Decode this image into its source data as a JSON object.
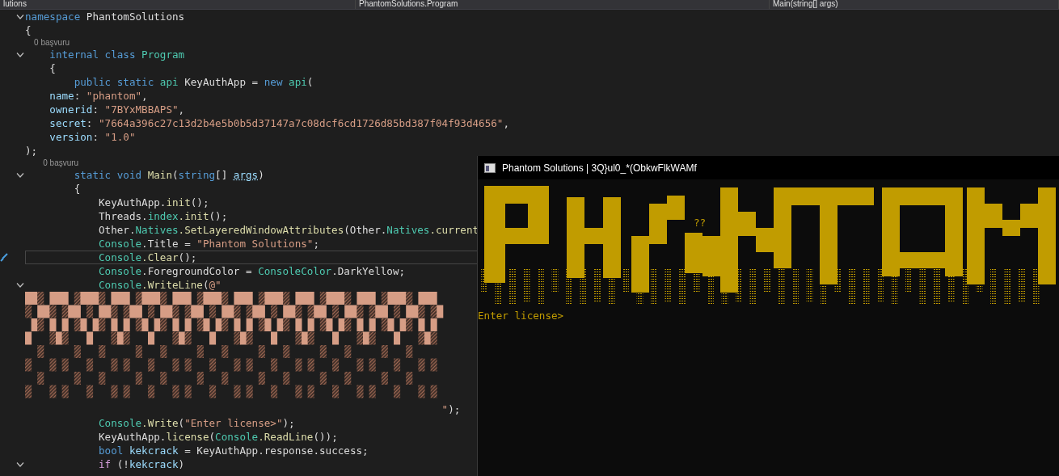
{
  "nav_bar": [
    {
      "label": "lutions"
    },
    {
      "label": "PhantomSolutions.Program"
    },
    {
      "label": "Main(string[] args)"
    }
  ],
  "code_lines": [
    {
      "kind": "code",
      "fold": true,
      "current": false,
      "tokens": [
        {
          "kind": "keyword",
          "text": "namespace "
        },
        {
          "kind": "plain",
          "text": "PhantomSolutions"
        }
      ]
    },
    {
      "kind": "code",
      "fold": false,
      "current": false,
      "tokens": [
        {
          "kind": "plain",
          "text": "{"
        }
      ]
    },
    {
      "kind": "codelens",
      "fold": false,
      "current": false,
      "tokens": [
        {
          "kind": "lens",
          "text": "    0 başvuru"
        }
      ]
    },
    {
      "kind": "code",
      "fold": true,
      "current": false,
      "tokens": [
        {
          "kind": "keyword",
          "text": "    internal class "
        },
        {
          "kind": "type",
          "text": "Program"
        }
      ]
    },
    {
      "kind": "code",
      "fold": false,
      "current": false,
      "tokens": [
        {
          "kind": "plain",
          "text": "    {"
        }
      ]
    },
    {
      "kind": "code",
      "fold": false,
      "current": false,
      "tokens": [
        {
          "kind": "keyword",
          "text": "        public static "
        },
        {
          "kind": "type",
          "text": "api"
        },
        {
          "kind": "plain",
          "text": " KeyAuthApp = "
        },
        {
          "kind": "keyword",
          "text": "new "
        },
        {
          "kind": "type",
          "text": "api"
        },
        {
          "kind": "plain",
          "text": "("
        }
      ]
    },
    {
      "kind": "code",
      "fold": false,
      "current": false,
      "tokens": [
        {
          "kind": "variable",
          "text": "    name"
        },
        {
          "kind": "plain",
          "text": ": "
        },
        {
          "kind": "string",
          "text": "\"phantom\""
        },
        {
          "kind": "plain",
          "text": ","
        }
      ]
    },
    {
      "kind": "code",
      "fold": false,
      "current": false,
      "tokens": [
        {
          "kind": "variable",
          "text": "    ownerid"
        },
        {
          "kind": "plain",
          "text": ": "
        },
        {
          "kind": "string",
          "text": "\"7BYxMBBAPS\""
        },
        {
          "kind": "plain",
          "text": ","
        }
      ]
    },
    {
      "kind": "code",
      "fold": false,
      "current": false,
      "tokens": [
        {
          "kind": "variable",
          "text": "    secret"
        },
        {
          "kind": "plain",
          "text": ": "
        },
        {
          "kind": "string",
          "text": "\"7664a396c27c13d2b4e5b0b5d37147a7c08dcf6cd1726d85bd387f04f93d4656\""
        },
        {
          "kind": "plain",
          "text": ","
        }
      ]
    },
    {
      "kind": "code",
      "fold": false,
      "current": false,
      "tokens": [
        {
          "kind": "variable",
          "text": "    version"
        },
        {
          "kind": "plain",
          "text": ": "
        },
        {
          "kind": "string",
          "text": "\"1.0\""
        }
      ]
    },
    {
      "kind": "code",
      "fold": false,
      "current": false,
      "tokens": [
        {
          "kind": "plain",
          "text": ");"
        }
      ]
    },
    {
      "kind": "codelens",
      "fold": false,
      "current": false,
      "tokens": [
        {
          "kind": "lens",
          "text": "        0 başvuru"
        }
      ]
    },
    {
      "kind": "code",
      "fold": true,
      "current": false,
      "tokens": [
        {
          "kind": "keyword",
          "text": "        static void "
        },
        {
          "kind": "method",
          "text": "Main"
        },
        {
          "kind": "plain",
          "text": "("
        },
        {
          "kind": "keyword",
          "text": "string"
        },
        {
          "kind": "plain",
          "text": "[] "
        },
        {
          "kind": "parameter",
          "text": "args"
        },
        {
          "kind": "plain",
          "text": ")"
        }
      ]
    },
    {
      "kind": "code",
      "fold": false,
      "current": false,
      "tokens": [
        {
          "kind": "plain",
          "text": "        {"
        }
      ]
    },
    {
      "kind": "code",
      "fold": false,
      "current": false,
      "tokens": [
        {
          "kind": "plain",
          "text": "            KeyAuthApp."
        },
        {
          "kind": "method",
          "text": "init"
        },
        {
          "kind": "plain",
          "text": "();"
        }
      ]
    },
    {
      "kind": "code",
      "fold": false,
      "current": false,
      "tokens": [
        {
          "kind": "plain",
          "text": "            Threads."
        },
        {
          "kind": "type",
          "text": "index"
        },
        {
          "kind": "method",
          "text": ".init"
        },
        {
          "kind": "plain",
          "text": "();"
        }
      ]
    },
    {
      "kind": "code",
      "fold": false,
      "current": false,
      "tokens": [
        {
          "kind": "plain",
          "text": "            Other."
        },
        {
          "kind": "type",
          "text": "Natives"
        },
        {
          "kind": "method",
          "text": ".SetLayeredWindowAttributes"
        },
        {
          "kind": "plain",
          "text": "(Other."
        },
        {
          "kind": "type",
          "text": "Natives"
        },
        {
          "kind": "method",
          "text": ".current"
        }
      ]
    },
    {
      "kind": "code",
      "fold": false,
      "current": false,
      "tokens": [
        {
          "kind": "type",
          "text": "            Console"
        },
        {
          "kind": "plain",
          "text": ".Title = "
        },
        {
          "kind": "string",
          "text": "\"Phantom Solutions\""
        },
        {
          "kind": "plain",
          "text": ";"
        }
      ]
    },
    {
      "kind": "code",
      "fold": false,
      "current": true,
      "tokens": [
        {
          "kind": "type",
          "text": "            Console"
        },
        {
          "kind": "method",
          "text": ".Clear"
        },
        {
          "kind": "plain",
          "text": "();"
        }
      ]
    },
    {
      "kind": "code",
      "fold": false,
      "current": false,
      "tokens": [
        {
          "kind": "type",
          "text": "            Console"
        },
        {
          "kind": "plain",
          "text": ".ForegroundColor = "
        },
        {
          "kind": "type",
          "text": "ConsoleColor"
        },
        {
          "kind": "plain",
          "text": ".DarkYellow;"
        }
      ]
    },
    {
      "kind": "code",
      "fold": true,
      "current": false,
      "tokens": [
        {
          "kind": "type",
          "text": "            Console"
        },
        {
          "kind": "method",
          "text": ".WriteLine"
        },
        {
          "kind": "plain",
          "text": "("
        },
        {
          "kind": "string",
          "text": "@\""
        }
      ]
    },
    {
      "kind": "art",
      "fold": false,
      "current": false
    },
    {
      "kind": "code",
      "fold": false,
      "current": false,
      "tokens": [
        {
          "kind": "string",
          "text": "                                                                    \""
        },
        {
          "kind": "plain",
          "text": ");"
        }
      ]
    },
    {
      "kind": "code",
      "fold": false,
      "current": false,
      "tokens": [
        {
          "kind": "type",
          "text": "            Console"
        },
        {
          "kind": "method",
          "text": ".Write"
        },
        {
          "kind": "plain",
          "text": "("
        },
        {
          "kind": "string",
          "text": "\"Enter license>\""
        },
        {
          "kind": "plain",
          "text": ");"
        }
      ]
    },
    {
      "kind": "code",
      "fold": false,
      "current": false,
      "tokens": [
        {
          "kind": "plain",
          "text": "            KeyAuthApp."
        },
        {
          "kind": "method",
          "text": "license"
        },
        {
          "kind": "plain",
          "text": "("
        },
        {
          "kind": "type",
          "text": "Console"
        },
        {
          "kind": "method",
          "text": ".ReadLine"
        },
        {
          "kind": "plain",
          "text": "());"
        }
      ]
    },
    {
      "kind": "code",
      "fold": false,
      "current": false,
      "tokens": [
        {
          "kind": "keyword",
          "text": "            bool "
        },
        {
          "kind": "variable",
          "text": "kekcrack"
        },
        {
          "kind": "plain",
          "text": " = KeyAuthApp.response.success;"
        }
      ]
    },
    {
      "kind": "code",
      "fold": true,
      "current": false,
      "tokens": [
        {
          "kind": "control",
          "text": "            if"
        },
        {
          "kind": "plain",
          "text": " (!"
        },
        {
          "kind": "variable",
          "text": "kekcrack"
        },
        {
          "kind": "plain",
          "text": ")"
        }
      ]
    }
  ],
  "console": {
    "title": "Phantom Solutions | 3Q}ul0_*(ObkwFlkWAMf",
    "marks": "??",
    "prompt": "Enter license>"
  }
}
